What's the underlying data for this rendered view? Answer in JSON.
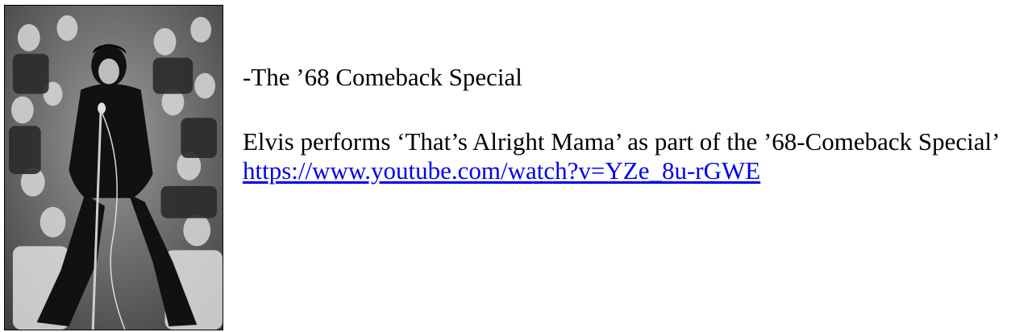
{
  "photo": {
    "icon": "performer-photo",
    "alt_kind": "black-and-white concert photograph"
  },
  "content": {
    "heading": "-The ’68 Comeback Special",
    "description": "Elvis performs ‘That’s Alright Mama’ as part of the ’68-Comeback Special’",
    "link_text": "https://www.youtube.com/watch?v=YZe_8u-rGWE",
    "link_color": "#0000ee"
  }
}
